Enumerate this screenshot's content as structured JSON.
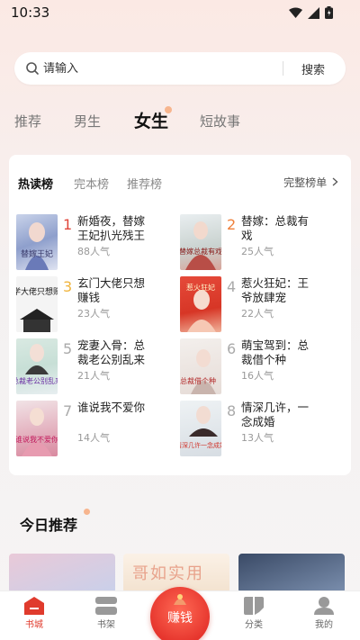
{
  "status_bar": {
    "time": "10:33"
  },
  "search": {
    "placeholder": "请输入",
    "button_label": "搜索"
  },
  "tabs": [
    {
      "label": "推荐",
      "active": false
    },
    {
      "label": "男生",
      "active": false
    },
    {
      "label": "女生",
      "active": true
    },
    {
      "label": "短故事",
      "active": false
    }
  ],
  "ranking": {
    "tabs": [
      {
        "label": "热读榜",
        "active": true
      },
      {
        "label": "完本榜",
        "active": false
      },
      {
        "label": "推荐榜",
        "active": false
      }
    ],
    "full_list_label": "完整榜单",
    "books": [
      {
        "rank": "1",
        "title": "新婚夜，替嫁王妃扒光残王",
        "popularity": "88人气",
        "rank_color": "#e0463b"
      },
      {
        "rank": "2",
        "title": "替嫁：总裁有戏",
        "popularity": "25人气",
        "rank_color": "#ef7f39"
      },
      {
        "rank": "3",
        "title": "玄门大佬只想赚钱",
        "popularity": "23人气",
        "rank_color": "#f0b43c"
      },
      {
        "rank": "4",
        "title": "惹火狂妃：王爷放肆宠",
        "popularity": "22人气",
        "rank_color": "#aaaaaa"
      },
      {
        "rank": "5",
        "title": "宠妻入骨：总裁老公别乱来",
        "popularity": "21人气",
        "rank_color": "#aaaaaa"
      },
      {
        "rank": "6",
        "title": "萌宝驾到：总裁借个种",
        "popularity": "16人气",
        "rank_color": "#aaaaaa"
      },
      {
        "rank": "7",
        "title": "谁说我不爱你",
        "popularity": "14人气",
        "rank_color": "#aaaaaa"
      },
      {
        "rank": "8",
        "title": "情深几许，一念成婚",
        "popularity": "13人气",
        "rank_color": "#aaaaaa"
      }
    ],
    "cover_texts": [
      "替嫁王妃",
      "玄学大佬只想赚钱",
      "总裁老公别乱来",
      "谁说我不爱你",
      "替嫁总裁有戏",
      "惹火狂妃",
      "总裁借个种",
      "情深几许一念成婚"
    ]
  },
  "daily": {
    "title": "今日推荐",
    "cover_texts": [
      "哥如实用"
    ]
  },
  "bottom_nav": {
    "items": [
      {
        "label": "书城",
        "active": true
      },
      {
        "label": "书架",
        "active": false
      },
      {
        "label": "分类",
        "active": false
      },
      {
        "label": "我的",
        "active": false
      }
    ],
    "earn_label": "赚钱"
  },
  "colors": {
    "accent": "#e03b2d",
    "tab_dot": "#f7b58e"
  }
}
